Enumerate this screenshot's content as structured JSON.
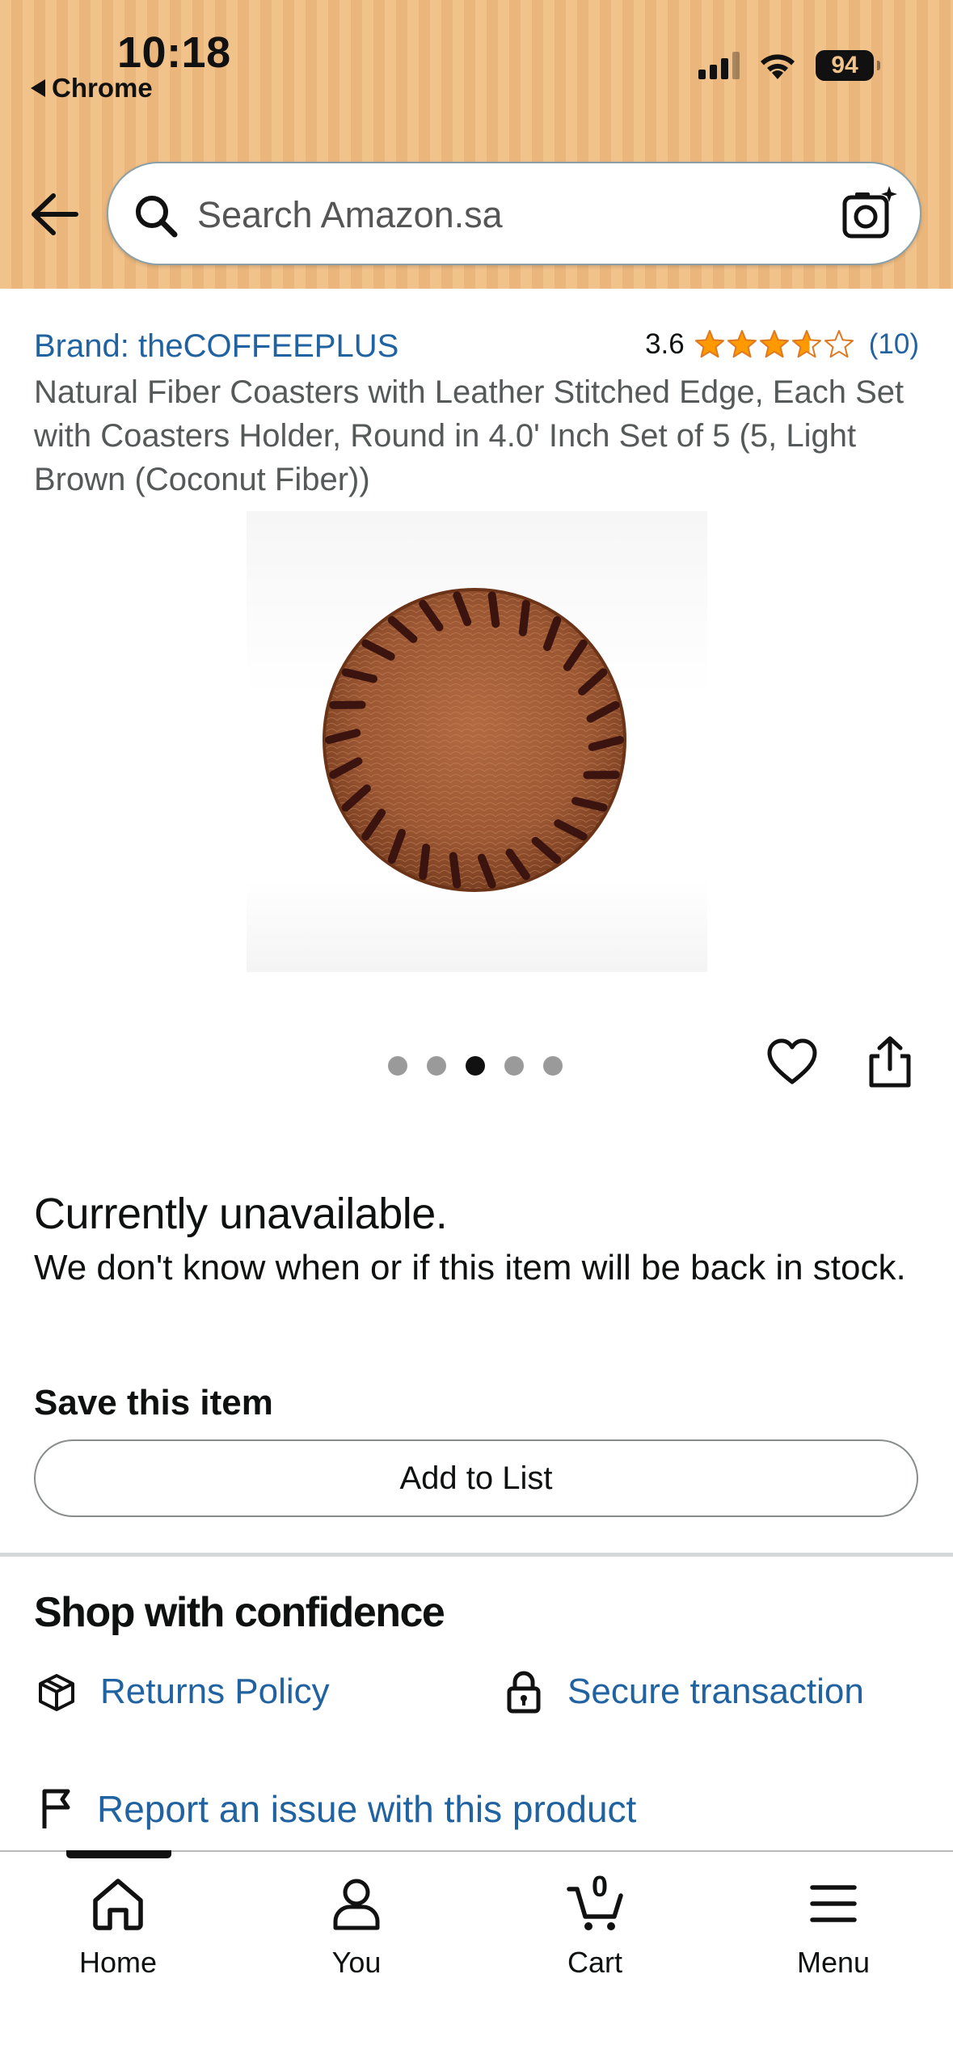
{
  "status_bar": {
    "time": "10:18",
    "back_app": "Chrome",
    "battery": "94"
  },
  "header": {
    "search_placeholder": "Search Amazon.sa",
    "background_color": "#f2c28b"
  },
  "product": {
    "brand": "Brand: theCOFFEEPLUS",
    "rating_value": "3.6",
    "rating_stars": 3.6,
    "rating_count": "(10)",
    "title": "Natural Fiber Coasters with Leather Stitched Edge, Each Set with Coasters Holder, Round in 4.0' Inch Set of 5 (5, Light Brown (Coconut Fiber))",
    "image_count": 5,
    "active_image_index": 2
  },
  "availability": {
    "heading": "Currently unavailable.",
    "message": "We don't know when or if this item will be back in stock.",
    "save_label": "Save this item",
    "add_to_list_label": "Add to List"
  },
  "confidence": {
    "heading": "Shop with confidence",
    "returns_label": "Returns Policy",
    "secure_label": "Secure transaction",
    "report_label": "Report an issue with this product"
  },
  "bottom_nav": {
    "items": [
      {
        "label": "Home",
        "icon": "home-icon"
      },
      {
        "label": "You",
        "icon": "user-icon"
      },
      {
        "label": "Cart",
        "icon": "cart-icon"
      },
      {
        "label": "Menu",
        "icon": "menu-icon"
      }
    ],
    "cart_count": "0",
    "active": "Home"
  },
  "colors": {
    "link": "#2162a1",
    "star": "#ff9900",
    "text": "#0f1111"
  }
}
